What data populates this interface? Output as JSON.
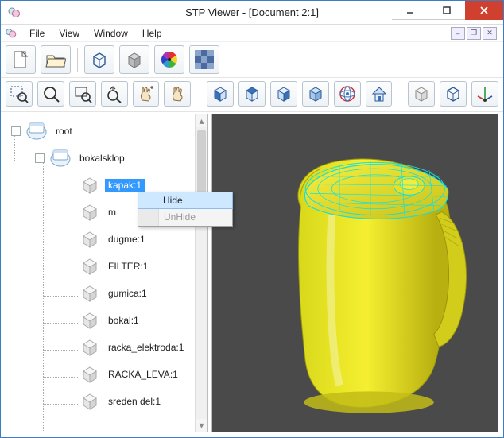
{
  "window": {
    "title": "STP Viewer - [Document 2:1]"
  },
  "menu": {
    "file": "File",
    "view": "View",
    "window": "Window",
    "help": "Help"
  },
  "toolbar1": {
    "new": "new-document",
    "open": "open-folder",
    "sep": true
  },
  "tree": {
    "root": {
      "label": "root",
      "expanded": true
    },
    "assembly": {
      "label": "bokalsklop",
      "expanded": true
    },
    "items": [
      {
        "label": "kapak:1",
        "selected": true
      },
      {
        "label": "m"
      },
      {
        "label": "dugme:1"
      },
      {
        "label": "FILTER:1"
      },
      {
        "label": "gumica:1"
      },
      {
        "label": "bokal:1"
      },
      {
        "label": "racka_elektroda:1"
      },
      {
        "label": "RACKA_LEVA:1"
      },
      {
        "label": "sreden del:1"
      }
    ]
  },
  "context_menu": {
    "hide": "Hide",
    "unhide": "UnHide"
  }
}
